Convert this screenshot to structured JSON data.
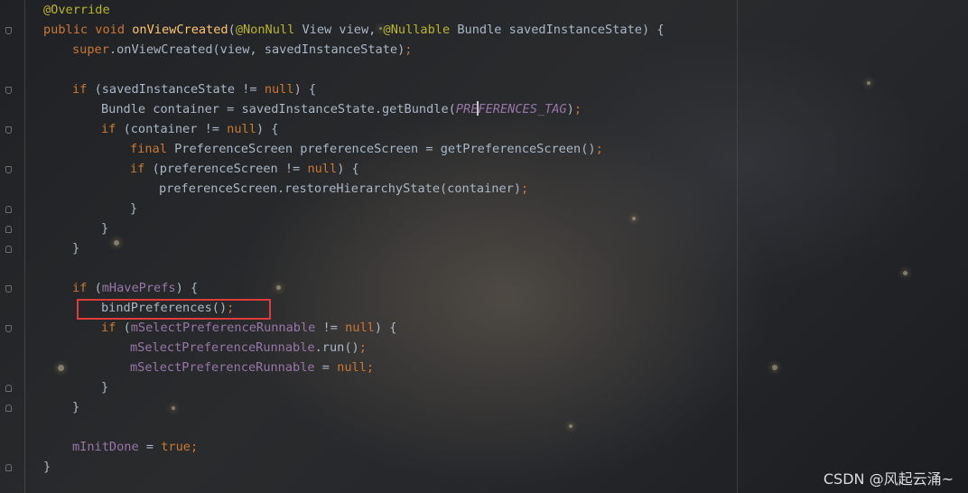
{
  "colors": {
    "keyword": "#cc7832",
    "annotation": "#bbb529",
    "method_declaration": "#ffc66d",
    "identifier": "#a9b7c6",
    "field": "#9876aa",
    "highlight_box": "#e03b3b"
  },
  "editor": {
    "lines": [
      {
        "tokens": [
          {
            "t": "ann",
            "v": "@Override"
          }
        ]
      },
      {
        "tokens": [
          {
            "t": "kw",
            "v": "public void "
          },
          {
            "t": "fn",
            "v": "onViewCreated"
          },
          {
            "t": "tx",
            "v": "("
          },
          {
            "t": "ann",
            "v": "@NonNull"
          },
          {
            "t": "tx",
            "v": " View view, "
          },
          {
            "t": "ann",
            "v": "@Nullable"
          },
          {
            "t": "tx",
            "v": " Bundle savedInstanceState) {"
          }
        ]
      },
      {
        "tokens": [
          {
            "t": "kw",
            "v": "super"
          },
          {
            "t": "tx",
            "v": ".onViewCreated(view, savedInstanceState)"
          },
          {
            "t": "kw",
            "v": ";"
          }
        ]
      },
      {
        "tokens": []
      },
      {
        "tokens": [
          {
            "t": "kw",
            "v": "if "
          },
          {
            "t": "tx",
            "v": "(savedInstanceState != "
          },
          {
            "t": "kw",
            "v": "null"
          },
          {
            "t": "tx",
            "v": ") {"
          }
        ]
      },
      {
        "tokens": [
          {
            "t": "tx",
            "v": "Bundle container = savedInstanceState.getBundle("
          },
          {
            "t": "cst",
            "v": "PRE"
          },
          {
            "t": "cursor",
            "v": ""
          },
          {
            "t": "cst",
            "v": "FERENCES_TAG"
          },
          {
            "t": "tx",
            "v": ")"
          },
          {
            "t": "kw",
            "v": ";"
          }
        ]
      },
      {
        "tokens": [
          {
            "t": "kw",
            "v": "if "
          },
          {
            "t": "tx",
            "v": "(container != "
          },
          {
            "t": "kw",
            "v": "null"
          },
          {
            "t": "tx",
            "v": ") {"
          }
        ]
      },
      {
        "tokens": [
          {
            "t": "kw",
            "v": "final "
          },
          {
            "t": "tx",
            "v": "PreferenceScreen preferenceScreen = getPreferenceScreen()"
          },
          {
            "t": "kw",
            "v": ";"
          }
        ]
      },
      {
        "tokens": [
          {
            "t": "kw",
            "v": "if "
          },
          {
            "t": "tx",
            "v": "(preferenceScreen != "
          },
          {
            "t": "kw",
            "v": "null"
          },
          {
            "t": "tx",
            "v": ") {"
          }
        ]
      },
      {
        "tokens": [
          {
            "t": "tx",
            "v": "preferenceScreen.restoreHierarchyState(container)"
          },
          {
            "t": "kw",
            "v": ";"
          }
        ]
      },
      {
        "tokens": [
          {
            "t": "tx",
            "v": "}"
          }
        ]
      },
      {
        "tokens": [
          {
            "t": "tx",
            "v": "}"
          }
        ]
      },
      {
        "tokens": [
          {
            "t": "tx",
            "v": "}"
          }
        ]
      },
      {
        "tokens": []
      },
      {
        "tokens": [
          {
            "t": "kw",
            "v": "if "
          },
          {
            "t": "tx",
            "v": "("
          },
          {
            "t": "fld",
            "v": "mHavePrefs"
          },
          {
            "t": "tx",
            "v": ") {"
          }
        ]
      },
      {
        "tokens": [
          {
            "t": "tx",
            "v": "bindPreferences()"
          },
          {
            "t": "kw",
            "v": ";"
          }
        ]
      },
      {
        "tokens": [
          {
            "t": "kw",
            "v": "if "
          },
          {
            "t": "tx",
            "v": "("
          },
          {
            "t": "fld",
            "v": "mSelectPreferenceRunnable"
          },
          {
            "t": "tx",
            "v": " != "
          },
          {
            "t": "kw",
            "v": "null"
          },
          {
            "t": "tx",
            "v": ") {"
          }
        ]
      },
      {
        "tokens": [
          {
            "t": "fld",
            "v": "mSelectPreferenceRunnable"
          },
          {
            "t": "tx",
            "v": ".run()"
          },
          {
            "t": "kw",
            "v": ";"
          }
        ]
      },
      {
        "tokens": [
          {
            "t": "fld",
            "v": "mSelectPreferenceRunnable"
          },
          {
            "t": "tx",
            "v": " = "
          },
          {
            "t": "kw",
            "v": "null;"
          }
        ]
      },
      {
        "tokens": [
          {
            "t": "tx",
            "v": "}"
          }
        ]
      },
      {
        "tokens": [
          {
            "t": "tx",
            "v": "}"
          }
        ]
      },
      {
        "tokens": []
      },
      {
        "tokens": [
          {
            "t": "fld",
            "v": "mInitDone"
          },
          {
            "t": "tx",
            "v": " = "
          },
          {
            "t": "kw",
            "v": "true;"
          }
        ]
      },
      {
        "tokens": [
          {
            "t": "tx",
            "v": "}"
          }
        ]
      }
    ]
  },
  "watermark": "CSDN @风起云涌~"
}
